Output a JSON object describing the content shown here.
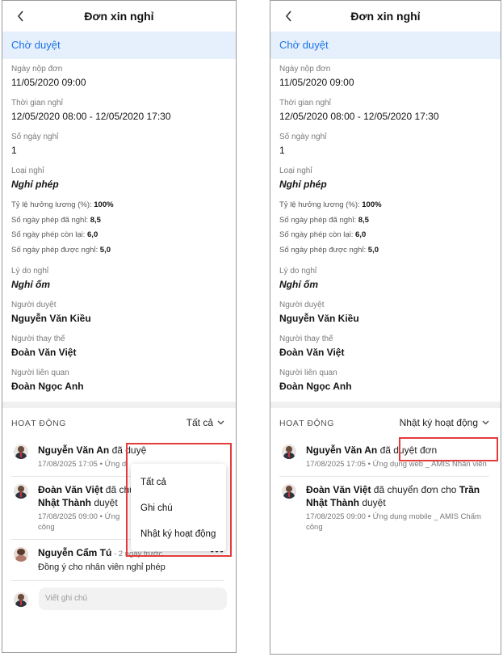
{
  "title": "Đơn xin nghỉ",
  "status": "Chờ duyệt",
  "fields": {
    "submit_date_label": "Ngày nộp đơn",
    "submit_date": "11/05/2020 09:00",
    "leave_time_label": "Thời gian nghỉ",
    "leave_time": "12/05/2020 08:00 - 12/05/2020 17:30",
    "days_label": "Số ngày nghỉ",
    "days": "1",
    "type_label": "Loại nghỉ",
    "type": "Nghỉ phép",
    "reason_label": "Lý do nghỉ",
    "reason": "Nghỉ ốm",
    "approver_label": "Người duyệt",
    "approver": "Nguyễn Văn Kiều",
    "substitute_label": "Người thay thế",
    "substitute": "Đoàn Văn Việt",
    "related_label": "Người liên quan",
    "related": "Đoàn Ngọc Anh"
  },
  "ratios": {
    "salary_label": "Tỷ lệ hưởng lương (%):",
    "salary": "100%",
    "used_label": "Số ngày phép đã nghỉ:",
    "used": "8,5",
    "remaining_label": "Số ngày phép còn lại:",
    "remaining": "6,0",
    "allowed_label": "Số ngày phép được nghỉ:",
    "allowed": "5,0"
  },
  "activity": {
    "title": "HOẠT ĐỘNG",
    "filter_left": "Tất cả",
    "filter_right": "Nhật ký hoạt động",
    "dropdown": [
      "Tất cả",
      "Ghi chú",
      "Nhật ký hoạt động"
    ],
    "items": [
      {
        "name": "Nguyễn Văn An",
        "action": " đã duyệt đơn",
        "action_truncated": " đã duyệ",
        "meta": "17/08/2025 17:05 • Ứng dụng web _ AMIS Nhân viên",
        "meta_truncated": "17/08/2025 17:05 • Ứng d"
      },
      {
        "name": "Đoàn Văn Việt",
        "action": " đã chuyển đơn cho ",
        "action_truncated": " đã chu",
        "target": "Trần Nhật Thành",
        "target_truncated": "Nhật Thành",
        "suffix": " duyệt",
        "meta": "17/08/2025 09:00 • Ứng dụng mobile _ AMIS Chấm công",
        "meta_truncated_1": "17/08/2025 09:00 • Ứng",
        "meta_truncated_2": "công"
      },
      {
        "name": "Nguyễn Cẩm Tú",
        "time": " - 2 ngày trước",
        "text": "Đồng ý cho nhân viên nghỉ phép",
        "more": "•••"
      }
    ],
    "comment_placeholder": "Viết ghi chú"
  },
  "colors": {
    "accent": "#1a73e8",
    "status_bg": "#e6f0fc",
    "highlight": "#e53b3b"
  }
}
